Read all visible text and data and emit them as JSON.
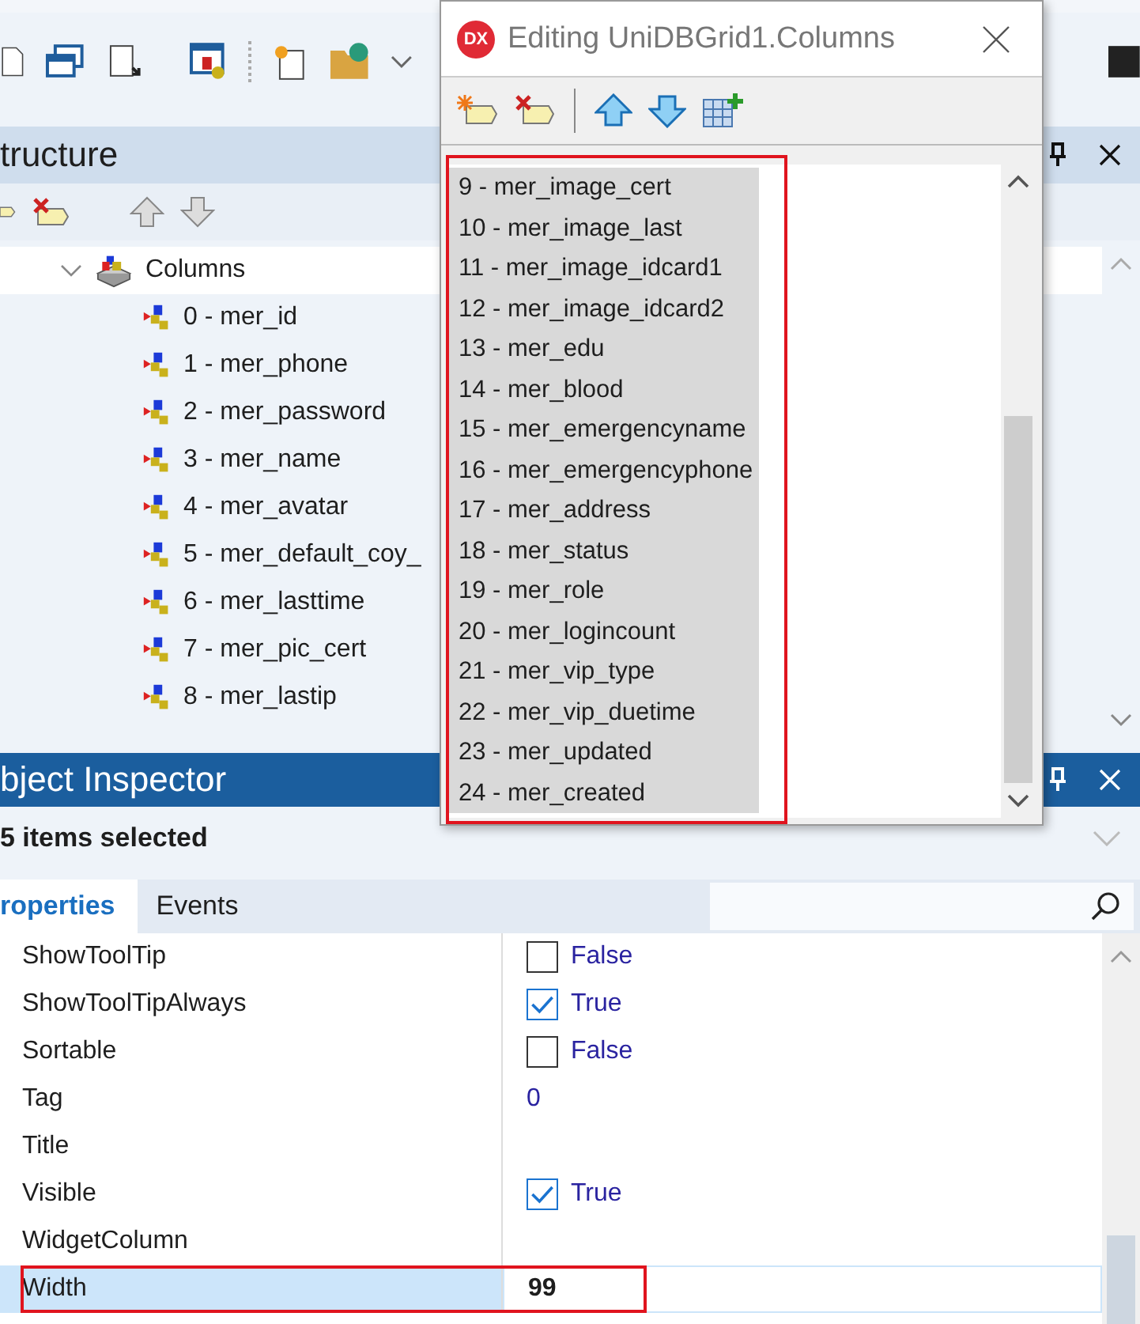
{
  "structure": {
    "title": "tructure",
    "tree": [
      {
        "label": "Columns",
        "selected": true,
        "expanded": true,
        "children": [
          {
            "label": "0 - mer_id"
          },
          {
            "label": "1 - mer_phone"
          },
          {
            "label": "2 - mer_password"
          },
          {
            "label": "3 - mer_name"
          },
          {
            "label": "4 - mer_avatar"
          },
          {
            "label": "5 - mer_default_coy_"
          },
          {
            "label": "6 - mer_lasttime"
          },
          {
            "label": "7 - mer_pic_cert"
          },
          {
            "label": "8 - mer_lastip"
          }
        ]
      }
    ]
  },
  "inspector": {
    "title": "bject Inspector",
    "selection": "5 items selected",
    "tabs": [
      {
        "label": "roperties",
        "selected": true
      },
      {
        "label": "Events",
        "selected": false
      }
    ],
    "properties": [
      {
        "name": "ShowToolTip",
        "kind": "check",
        "checked": false,
        "value": "False",
        "selected": false
      },
      {
        "name": "ShowToolTipAlways",
        "kind": "check",
        "checked": true,
        "value": "True",
        "selected": false
      },
      {
        "name": "Sortable",
        "kind": "check",
        "checked": false,
        "value": "False",
        "selected": false
      },
      {
        "name": "Tag",
        "kind": "number",
        "value": "0",
        "selected": false
      },
      {
        "name": "Title",
        "kind": "empty",
        "selected": false
      },
      {
        "name": "Visible",
        "kind": "check",
        "checked": true,
        "value": "True",
        "selected": false
      },
      {
        "name": "WidgetColumn",
        "kind": "empty",
        "selected": false
      },
      {
        "name": "Width",
        "kind": "edit",
        "value": "99",
        "selected": true
      }
    ]
  },
  "dialog": {
    "title": "Editing UniDBGrid1.Columns",
    "logo": "DX",
    "items": [
      {
        "label": "9 - mer_image_cert",
        "selected": true
      },
      {
        "label": "10 - mer_image_last",
        "selected": true
      },
      {
        "label": "11 - mer_image_idcard1",
        "selected": true
      },
      {
        "label": "12 - mer_image_idcard2",
        "selected": true
      },
      {
        "label": "13 - mer_edu",
        "selected": true
      },
      {
        "label": "14 - mer_blood",
        "selected": true
      },
      {
        "label": "15 - mer_emergencyname",
        "selected": true
      },
      {
        "label": "16 - mer_emergencyphone",
        "selected": true
      },
      {
        "label": "17 - mer_address",
        "selected": true
      },
      {
        "label": "18 - mer_status",
        "selected": true
      },
      {
        "label": "19 - mer_role",
        "selected": true
      },
      {
        "label": "20 - mer_logincount",
        "selected": true
      },
      {
        "label": "21 - mer_vip_type",
        "selected": true
      },
      {
        "label": "22 - mer_vip_duetime",
        "selected": true
      },
      {
        "label": "23 - mer_updated",
        "selected": true
      },
      {
        "label": "24 - mer_created",
        "selected": true
      }
    ]
  }
}
